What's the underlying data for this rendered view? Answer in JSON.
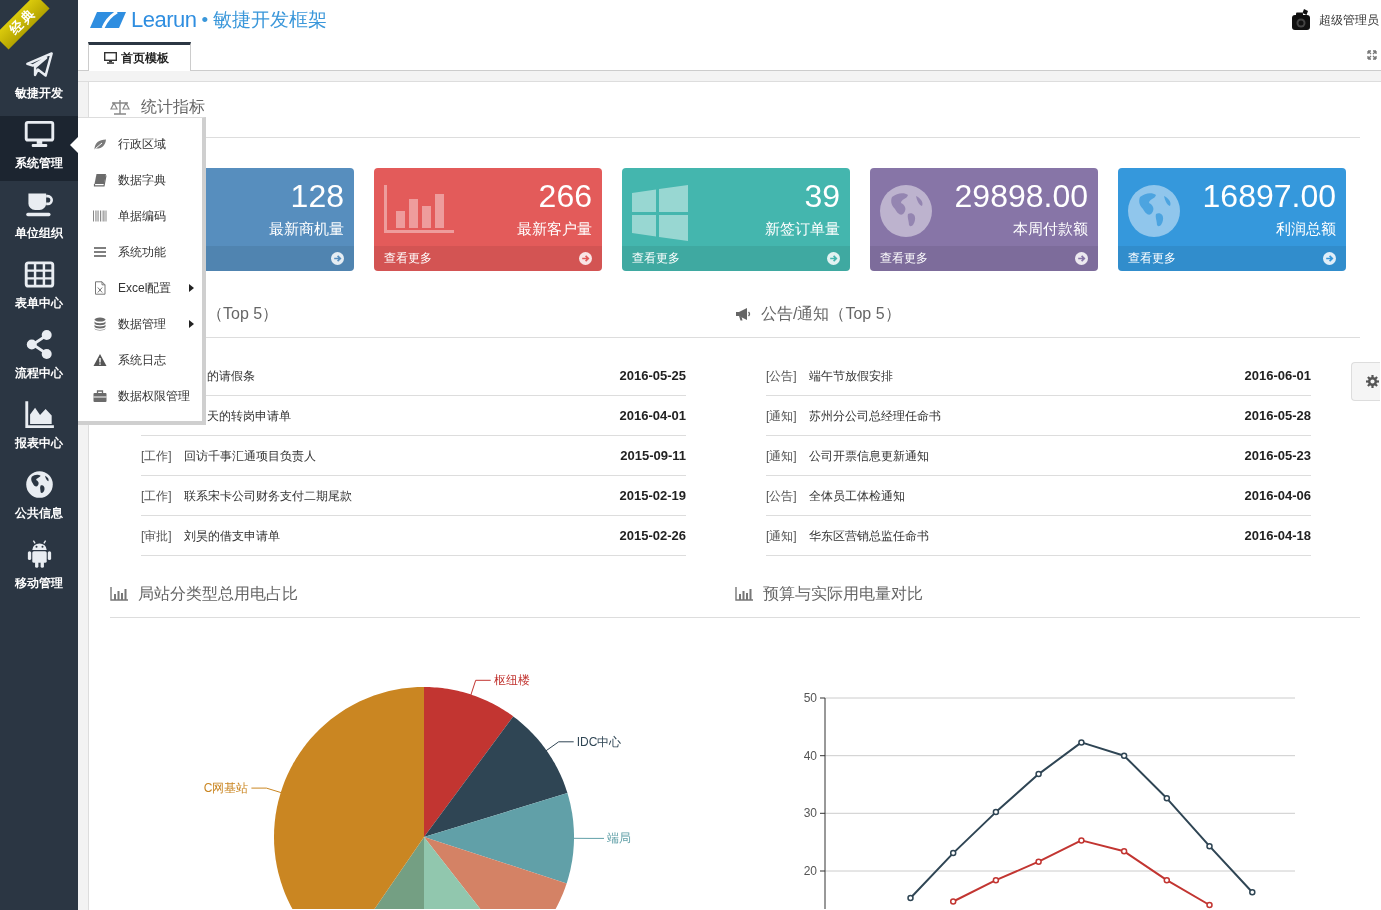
{
  "ribbon": {
    "label": "经典"
  },
  "sidebar": {
    "items": [
      {
        "label": "敏捷开发",
        "selected": false
      },
      {
        "label": "系统管理",
        "selected": true
      },
      {
        "label": "单位组织",
        "selected": false
      },
      {
        "label": "表单中心",
        "selected": false
      },
      {
        "label": "流程中心",
        "selected": false
      },
      {
        "label": "报表中心",
        "selected": false
      },
      {
        "label": "公共信息",
        "selected": false
      },
      {
        "label": "移动管理",
        "selected": false
      }
    ]
  },
  "submenu": {
    "items": [
      {
        "label": "行政区域",
        "has_submenu": false
      },
      {
        "label": "数据字典",
        "has_submenu": false
      },
      {
        "label": "单据编码",
        "has_submenu": false
      },
      {
        "label": "系统功能",
        "has_submenu": false
      },
      {
        "label": "Excel配置",
        "has_submenu": true
      },
      {
        "label": "数据管理",
        "has_submenu": true
      },
      {
        "label": "系统日志",
        "has_submenu": false
      },
      {
        "label": "数据权限管理",
        "has_submenu": false
      }
    ]
  },
  "header": {
    "brand": "Learun",
    "tagline": "• 敏捷开发框架",
    "user": "超级管理员"
  },
  "tabs": [
    {
      "label": "首页模板",
      "selected": true
    }
  ],
  "stats": {
    "title": "统计指标",
    "cards": [
      {
        "value": "128",
        "label": "最新商机量",
        "color": "#578ebe"
      },
      {
        "value": "266",
        "label": "最新客户量",
        "more": "查看更多",
        "color": "#e35b5a"
      },
      {
        "value": "39",
        "label": "新签订单量",
        "more": "查看更多",
        "color": "#44b6ae"
      },
      {
        "value": "29898.00",
        "label": "本周付款额",
        "more": "查看更多",
        "color": "#8775a7"
      },
      {
        "value": "16897.00",
        "label": "利润总额",
        "more": "查看更多",
        "color": "#3598dc"
      }
    ]
  },
  "todo": {
    "title": "（Top 5）",
    "rows": [
      {
        "title": "的请假条",
        "date": "2016-05-25"
      },
      {
        "title": "天的转岗申请单",
        "date": "2016-04-01"
      },
      {
        "tag": "[工作]",
        "title": "回访千事汇通项目负责人",
        "date": "2015-09-11"
      },
      {
        "tag": "[工作]",
        "title": "联系宋卡公司财务支付二期尾款",
        "date": "2015-02-19"
      },
      {
        "tag": "[审批]",
        "title": "刘昊的借支申请单",
        "date": "2015-02-26"
      }
    ]
  },
  "notices": {
    "title": "公告/通知（Top 5）",
    "rows": [
      {
        "tag": "[公告]",
        "title": "端午节放假安排",
        "date": "2016-06-01"
      },
      {
        "tag": "[通知]",
        "title": "苏州分公司总经理任命书",
        "date": "2016-05-28"
      },
      {
        "tag": "[通知]",
        "title": "公司开票信息更新通知",
        "date": "2016-05-23"
      },
      {
        "tag": "[公告]",
        "title": "全体员工体检通知",
        "date": "2016-04-06"
      },
      {
        "tag": "[通知]",
        "title": "华东区营销总监任命书",
        "date": "2016-04-18"
      }
    ]
  },
  "pie": {
    "title": "局站分类型总用电占比",
    "slices": [
      {
        "label": "枢纽楼",
        "color": "#c23531"
      },
      {
        "label": "IDC中心",
        "color": "#2f4554"
      },
      {
        "label": "端局",
        "color": "#61a0a8"
      },
      {
        "color": "#d48265"
      },
      {
        "color": "#91c7ae"
      },
      {
        "color": "#749f83"
      },
      {
        "label": "C网基站",
        "color": "#ca8622"
      }
    ]
  },
  "line": {
    "title": "预算与实际用电量对比",
    "chart_data": {
      "type": "line",
      "categories": [
        null,
        null,
        null,
        null,
        null,
        null,
        null,
        null,
        null,
        null,
        null,
        null
      ],
      "ylim": [
        13.4,
        50
      ],
      "yticks": [
        20,
        30,
        40,
        50
      ],
      "grid": true,
      "series": [
        {
          "color": "#2f4554",
          "marker": "circle",
          "values": [
            null,
            null,
            15.3,
            23.1,
            30.2,
            36.8,
            42.3,
            40.0,
            32.6,
            24.3,
            16.3,
            null
          ]
        },
        {
          "color": "#c23531",
          "marker": "circle",
          "values": [
            null,
            null,
            null,
            14.7,
            18.4,
            21.6,
            25.3,
            23.4,
            18.4,
            14.1,
            null,
            null
          ]
        }
      ]
    }
  }
}
